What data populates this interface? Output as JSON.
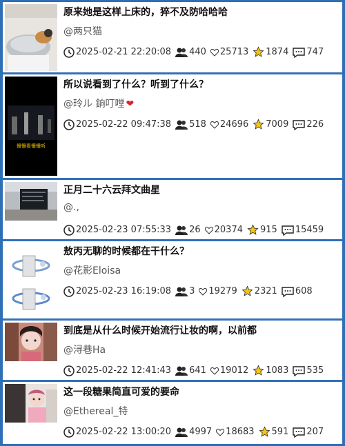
{
  "posts": [
    {
      "title": "原来她是这样上床的，猝不及防哈哈哈",
      "author": "@两只猫",
      "time": "2025-02-21 22:20:08",
      "viewers": "440",
      "likes": "25713",
      "stars": "1874",
      "comments": "747",
      "thumb_caption": ""
    },
    {
      "title": "所以说看到了什么？听到了什么？",
      "author": "@玲ル 銄叮嘡",
      "author_heart": "❤",
      "time": "2025-02-22 09:47:38",
      "viewers": "518",
      "likes": "24696",
      "stars": "7009",
      "comments": "226",
      "thumb_caption": "慢慢看慢慢听"
    },
    {
      "title": "正月二十六云拜文曲星",
      "author": "@.,",
      "time": "2025-02-23 07:55:33",
      "viewers": "26",
      "likes": "20374",
      "stars": "915",
      "comments": "15459",
      "thumb_caption": ""
    },
    {
      "title": "敖丙无聊的时候都在干什么？",
      "author": "@花影Eloisa",
      "time": "2025-02-23 16:19:08",
      "viewers": "3",
      "likes": "19279",
      "stars": "2321",
      "comments": "608",
      "thumb_caption": ""
    },
    {
      "title": "到底是从什么时候开始流行让妆的啊，以前都",
      "author": "@浔巷Ha",
      "time": "2025-02-22 12:41:43",
      "viewers": "641",
      "likes": "19012",
      "stars": "1083",
      "comments": "535",
      "thumb_caption": ""
    },
    {
      "title": "这一段糖果简直可爱的要命",
      "author": "@Ethereal_特",
      "time": "2025-02-22 13:00:20",
      "viewers": "4997",
      "likes": "18683",
      "stars": "591",
      "comments": "207",
      "thumb_caption": ""
    }
  ],
  "icons": {
    "clock": "clock-icon",
    "viewers": "people-icon",
    "likes": "heart-outline-icon",
    "stars": "star-icon",
    "comments": "comment-icon"
  },
  "colors": {
    "background": "#2f6fb8",
    "card": "#ffffff",
    "star": "#f5c518",
    "heart": "#d9242f"
  }
}
